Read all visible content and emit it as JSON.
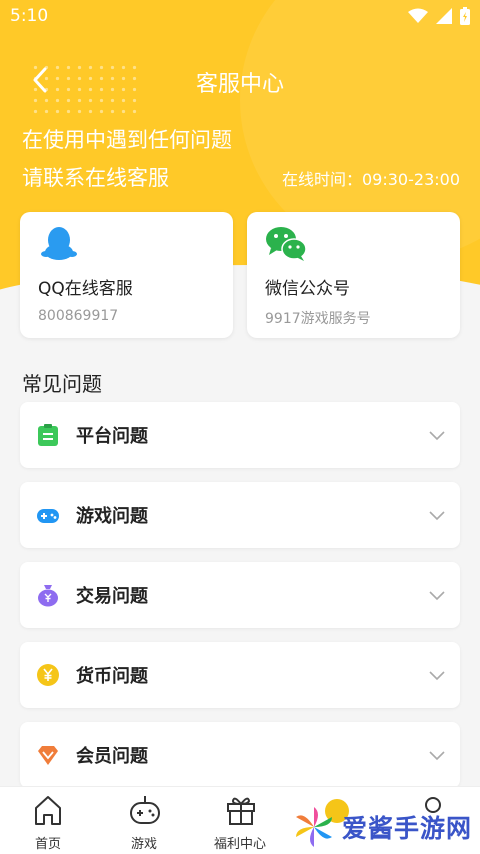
{
  "status_bar": {
    "time": "5:10"
  },
  "nav": {
    "title": "客服中心"
  },
  "intro": {
    "line1": "在使用中遇到任何问题",
    "line2": "请联系在线客服",
    "hours": "在线时间：09:30-23:00"
  },
  "contacts": [
    {
      "title": "QQ在线客服",
      "sub": "800869917",
      "icon": "qq-penguin-icon"
    },
    {
      "title": "微信公众号",
      "sub": "9917游戏服务号",
      "icon": "wechat-icon"
    }
  ],
  "faq": {
    "heading": "常见问题",
    "items": [
      {
        "label": "平台问题",
        "icon": "clipboard-icon",
        "color": "#3cc85a"
      },
      {
        "label": "游戏问题",
        "icon": "gamepad-icon",
        "color": "#2196f3"
      },
      {
        "label": "交易问题",
        "icon": "money-bag-icon",
        "color": "#8e6cf0"
      },
      {
        "label": "货币问题",
        "icon": "coin-icon",
        "color": "#f5c518"
      },
      {
        "label": "会员问题",
        "icon": "diamond-icon",
        "color": "#f07d3a"
      }
    ]
  },
  "tabbar": {
    "items": [
      {
        "label": "首页",
        "icon": "home-icon"
      },
      {
        "label": "游戏",
        "icon": "gamepad-icon"
      },
      {
        "label": "福利中心",
        "icon": "gift-icon"
      }
    ]
  },
  "watermark": {
    "text": "爱酱手游网"
  },
  "colors": {
    "accent": "#ffc928",
    "background": "#f5f5f5"
  }
}
